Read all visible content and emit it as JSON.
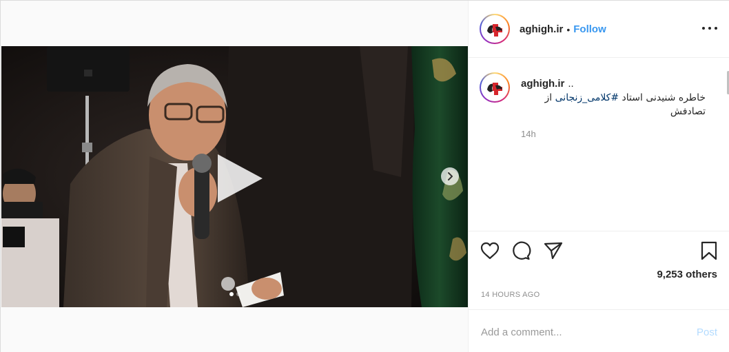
{
  "account": {
    "username": "aghigh.ir",
    "separator": "•",
    "follow_label": "Follow"
  },
  "caption": {
    "username": "aghigh.ir",
    "more": "..",
    "text_prefix": "خاطره شنیدنی استاد ",
    "hashtag": "#کلامی_زنجانی",
    "text_suffix": " از تصادفش",
    "time": "14h"
  },
  "stats": {
    "likes_text": "9,253 others",
    "posted_ago": "14 HOURS AGO"
  },
  "comment": {
    "placeholder": "Add a comment...",
    "post_label": "Post"
  },
  "media": {
    "type": "video",
    "slide_count": 2,
    "active_slide": 1
  },
  "icons": {
    "more": "more-options-icon",
    "like": "heart-icon",
    "comment": "comment-bubble-icon",
    "share": "paper-plane-icon",
    "save": "bookmark-icon",
    "play": "play-icon",
    "next": "chevron-right-icon"
  },
  "colors": {
    "accent": "#3897f0",
    "hashtag": "#003569",
    "muted": "#8e8e8e",
    "post_disabled": "#b3dbff"
  }
}
